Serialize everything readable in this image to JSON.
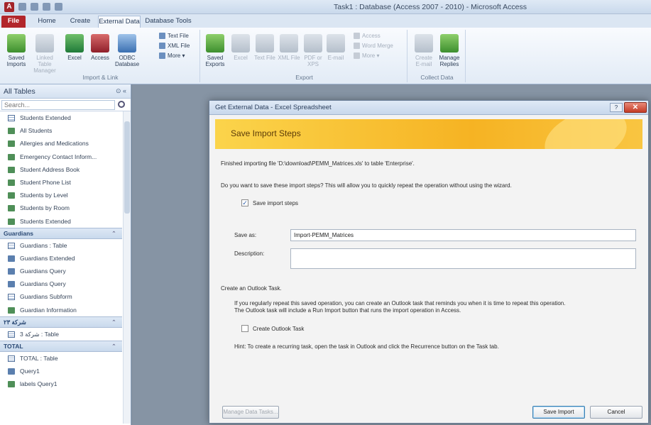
{
  "window": {
    "title": "Task1 : Database (Access 2007 - 2010)  -  Microsoft Access",
    "app_icon": "A"
  },
  "ribbon_tabs": [
    "File",
    "Home",
    "Create",
    "External Data",
    "Database Tools"
  ],
  "ribbon": {
    "import_group": {
      "label": "Import & Link",
      "saved_imports": "Saved Imports",
      "linked_table_manager": "Linked Table Manager",
      "excel": "Excel",
      "access": "Access",
      "odbc": "ODBC Database",
      "text_file": "Text File",
      "xml_file": "XML File",
      "more": "More"
    },
    "export_group": {
      "label": "Export",
      "saved_exports": "Saved Exports",
      "excel": "Excel",
      "text_file": "Text File",
      "xml_file": "XML File",
      "pdf": "PDF or XPS",
      "email": "E-mail",
      "access": "Access",
      "word_merge": "Word Merge",
      "more": "More"
    },
    "collect_group": {
      "label": "Collect Data",
      "create_email": "Create E-mail",
      "manage_replies": "Manage Replies"
    }
  },
  "navpane": {
    "title": "All Tables",
    "search_placeholder": "Search...",
    "items_top": [
      {
        "label": "Students Extended",
        "icon": "table"
      },
      {
        "label": "All Students",
        "icon": "report"
      },
      {
        "label": "Allergies and Medications",
        "icon": "report"
      },
      {
        "label": "Emergency Contact Inform...",
        "icon": "report"
      },
      {
        "label": "Student Address Book",
        "icon": "report"
      },
      {
        "label": "Student Phone List",
        "icon": "report"
      },
      {
        "label": "Students by Level",
        "icon": "report"
      },
      {
        "label": "Students by Room",
        "icon": "report"
      },
      {
        "label": "Students Extended",
        "icon": "report"
      }
    ],
    "group_guardians": "Guardians",
    "items_guardians": [
      {
        "label": "Guardians : Table",
        "icon": "table"
      },
      {
        "label": "Guardians Extended",
        "icon": "query"
      },
      {
        "label": "Guardians Query",
        "icon": "query"
      },
      {
        "label": "Guardians Query",
        "icon": "query"
      },
      {
        "label": "Guardians Subform",
        "icon": "table"
      },
      {
        "label": "Guardian Information",
        "icon": "report"
      }
    ],
    "group_3": "ﺷﺮﻛﺔ ٢٣",
    "items_3": [
      {
        "label": "ﺷﺮﻛﺔ 3 : Table",
        "icon": "table"
      }
    ],
    "group_total": "TOTAL",
    "items_total": [
      {
        "label": "TOTAL : Table",
        "icon": "table"
      },
      {
        "label": "Query1",
        "icon": "query"
      },
      {
        "label": "labels Query1",
        "icon": "report"
      }
    ]
  },
  "dialog": {
    "title": "Get External Data - Excel Spreadsheet",
    "help": "?",
    "banner_title": "Save Import Steps",
    "finished_msg": "Finished importing file 'D:\\download\\PEMM_Matrices.xls' to table 'Enterprise'.",
    "question": "Do you want to save these import steps? This will allow you to quickly repeat the operation without using the wizard.",
    "save_steps_label": "Save import steps",
    "save_steps_checked": true,
    "save_as_label": "Save as:",
    "save_as_value": "Import-PEMM_Matrices",
    "description_label": "Description:",
    "description_value": "",
    "outlook_heading": "Create an Outlook Task.",
    "outlook_desc_1": "If you regularly repeat this saved operation, you can create an Outlook task that reminds you when it is time to repeat this operation.",
    "outlook_desc_2": "The Outlook task will include a Run Import button that runs the import operation in Access.",
    "create_task_label": "Create Outlook Task",
    "create_task_checked": false,
    "hint": "Hint: To create a recurring task, open the task in Outlook and click the Recurrence button on the Task tab.",
    "manage_btn": "Manage Data Tasks...",
    "save_import_btn": "Save Import",
    "cancel_btn": "Cancel"
  }
}
